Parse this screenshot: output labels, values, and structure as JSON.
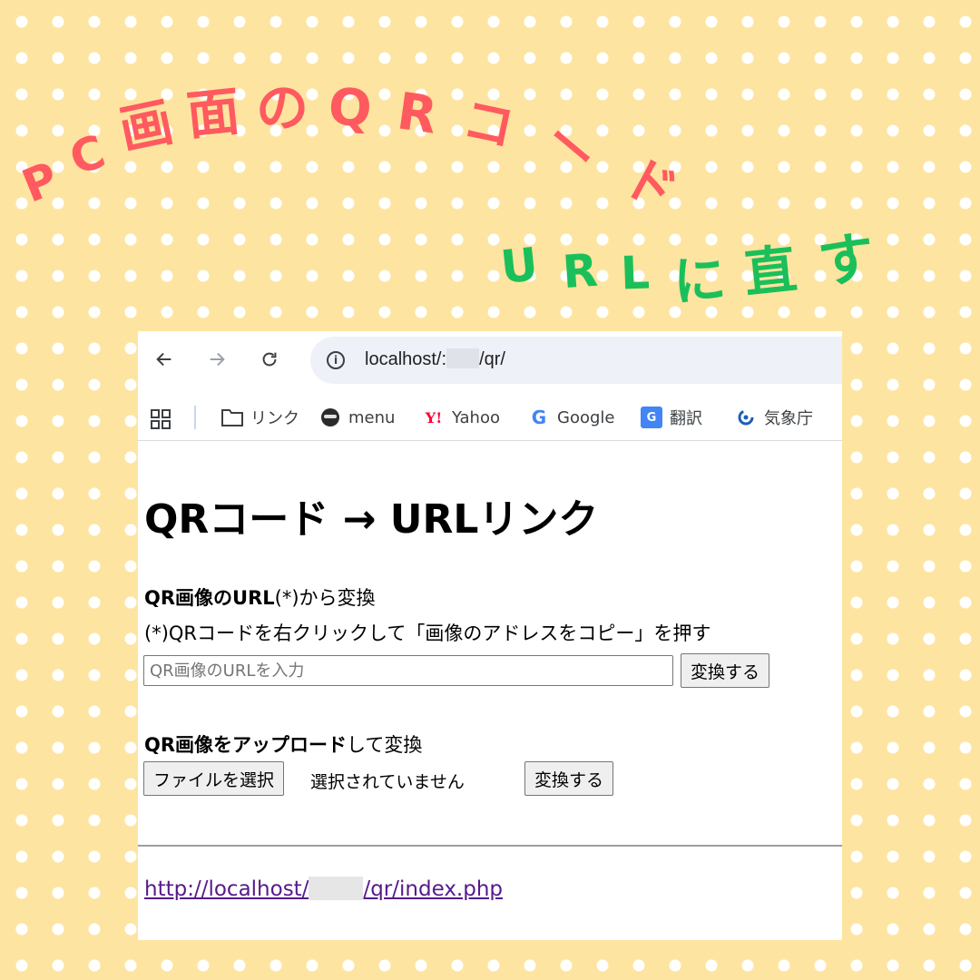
{
  "headline": {
    "chars": [
      "P",
      "C",
      "画",
      "面",
      "の",
      "Q",
      "R",
      "コ",
      "ー",
      "ド"
    ],
    "color": "#ff5a5f"
  },
  "subheadline": {
    "chars": [
      "U",
      "R",
      "L",
      "に",
      "直",
      "す"
    ],
    "color": "#1bbf5a"
  },
  "browser": {
    "nav": {
      "back_icon": "arrow-left-icon",
      "forward_icon": "arrow-right-icon",
      "reload_icon": "reload-icon",
      "url_prefix": "localhost/:",
      "url_suffix": "/qr/"
    },
    "bookmarks": {
      "apps_icon": "apps-grid-icon",
      "items": [
        {
          "label": "リンク",
          "icon": "folder-icon"
        },
        {
          "label": "menu",
          "icon": "menu-avatar-icon"
        },
        {
          "label": "Yahoo",
          "icon": "yahoo-icon",
          "icon_text": "Y!"
        },
        {
          "label": "Google",
          "icon": "google-icon",
          "icon_text": "G"
        },
        {
          "label": "翻訳",
          "icon": "translate-icon",
          "icon_text": "G"
        },
        {
          "label": "気象庁",
          "icon": "weather-icon"
        }
      ]
    }
  },
  "page": {
    "heading": "QRコード → URLリンク",
    "section1": {
      "title_bold": "QR画像のURL",
      "title_rest": "(*)から変換",
      "note": "(*)QRコードを右クリックして「画像のアドレスをコピー」を押す",
      "input_placeholder": "QR画像のURLを入力",
      "input_value": "",
      "convert_button": "変換する"
    },
    "section2": {
      "title_bold": "QR画像をアップロード",
      "title_rest": "して変換",
      "choose_file_button": "ファイルを選択",
      "no_file_text": "選択されていません",
      "convert_button": "変換する"
    },
    "footer_link": {
      "prefix": "http://localhost/",
      "suffix": "/qr/index.php"
    }
  }
}
